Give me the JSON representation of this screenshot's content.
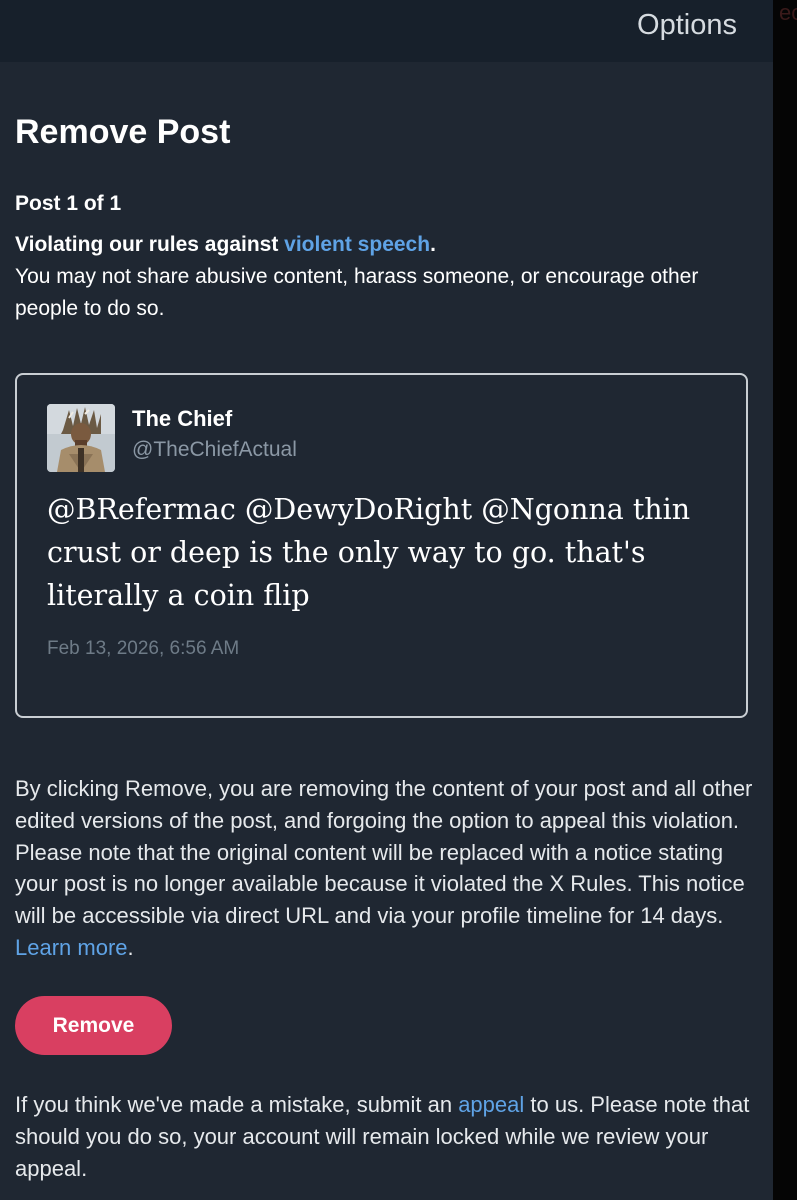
{
  "header": {
    "options_label": "Options",
    "edge_fragment": "ec"
  },
  "dialog": {
    "title": "Remove Post",
    "post_count": "Post 1 of 1",
    "violation_prefix": "Violating our rules against ",
    "violation_link": "violent speech",
    "violation_suffix": ".",
    "violation_description": "You may not share abusive content, harass someone, or encourage other people to do so."
  },
  "post": {
    "author_name": "The Chief",
    "author_handle": "@TheChiefActual",
    "text": "@BRefermac @DewyDoRight @Ngonna thin crust or deep is the only way to go. that's literally a coin flip",
    "timestamp": "Feb 13, 2026, 6:56 AM",
    "avatar_icon": "profile-photo-icon"
  },
  "explanation": {
    "text": "By clicking Remove, you are removing the content of your post and all other edited versions of the post, and forgoing the option to appeal this violation. Please note that the original content will be replaced with a notice stating your post is no longer available because it violated the X Rules. This notice will be accessible via direct URL and via your profile timeline for 14 days. ",
    "learn_more_label": "Learn more",
    "trailing": "."
  },
  "actions": {
    "remove_label": "Remove"
  },
  "appeal": {
    "prefix": "If you think we've made a mistake, submit an ",
    "link_label": "appeal",
    "suffix": " to us. Please note that should you do so, your account will remain locked while we review your appeal."
  },
  "colors": {
    "background": "#1f2732",
    "top_bar": "#17202b",
    "link": "#5fa3e6",
    "remove_button": "#d93f61",
    "secondary_text": "#8b98a5"
  }
}
